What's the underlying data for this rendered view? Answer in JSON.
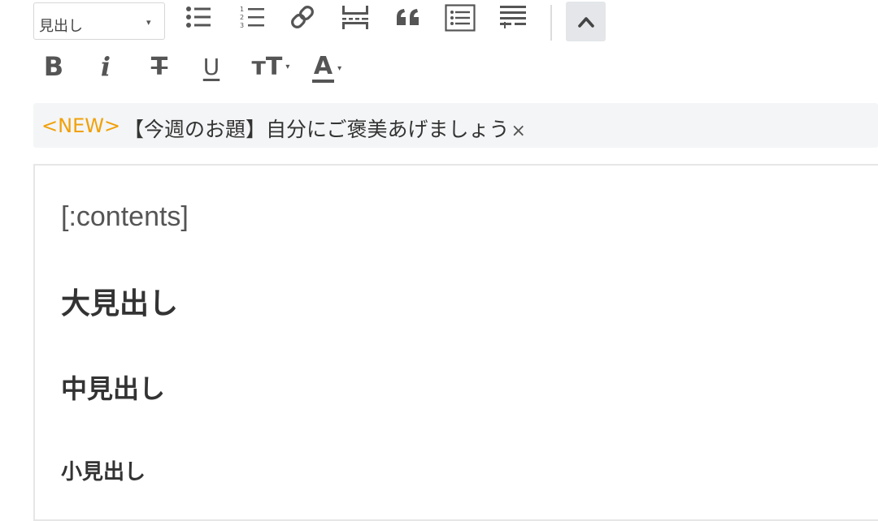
{
  "toolbar": {
    "heading_select": {
      "value": "見出し",
      "caret": "▾"
    },
    "row1_icons": [
      "bulleted-list-icon",
      "numbered-list-icon",
      "link-icon",
      "horizontal-rule-icon",
      "quote-icon",
      "toc-icon",
      "more-icon",
      "collapse-chevron-up-icon"
    ],
    "row2": {
      "bold": "B",
      "italic": "i",
      "strikethrough": "T",
      "underline": "U",
      "font_size": "ᴛT",
      "font_size_caret": "▾",
      "text_color": "A",
      "text_color_caret": "▾"
    }
  },
  "announcement": {
    "tag": "<NEW>",
    "message": "【今週のお題】自分にご褒美あげましょう",
    "close": "×"
  },
  "editor": {
    "contents_tag": "[:contents]",
    "heading_large": "大見出し",
    "heading_medium": "中見出し",
    "heading_small": "小見出し"
  },
  "colors": {
    "accent_new": "#f0a10a",
    "toolbar_icon": "#555555",
    "collapse_bg": "#e4e6e9"
  }
}
